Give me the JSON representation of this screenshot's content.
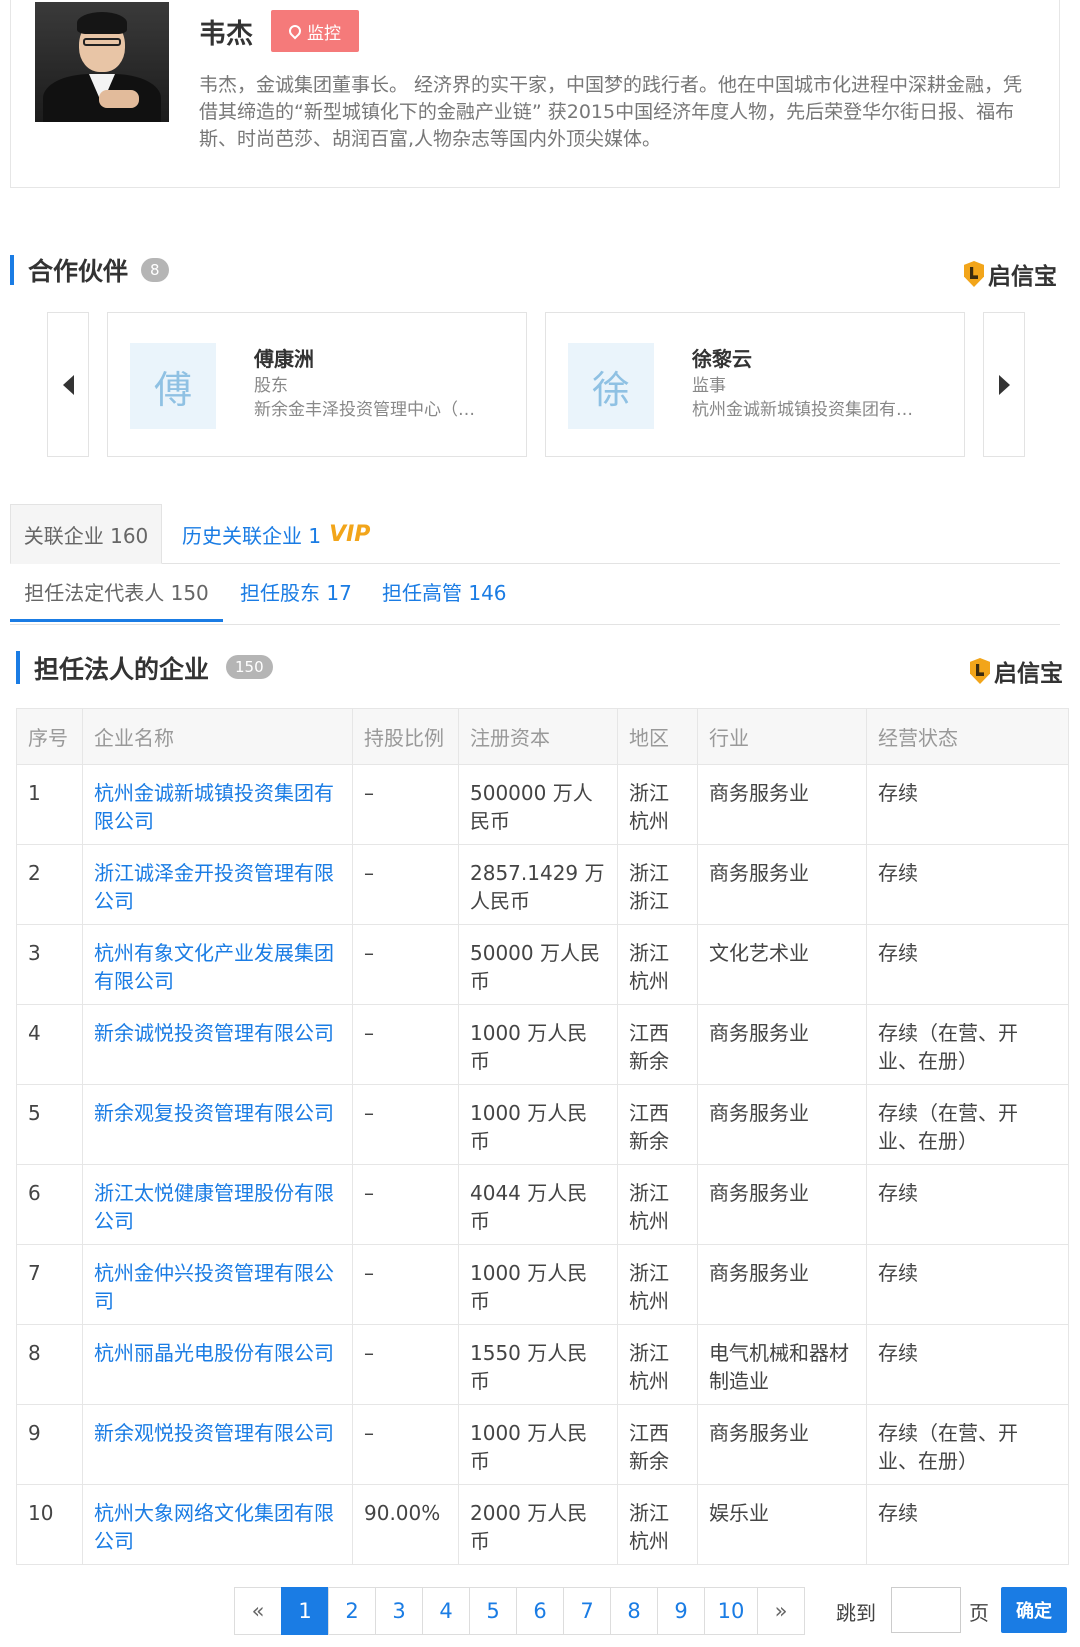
{
  "profile": {
    "name": "韦杰",
    "monitor_label": "监控",
    "bio": "韦杰，金诚集团董事长。 经济界的实干家，中国梦的践行者。他在中国城市化进程中深耕金融，凭借其缔造的“新型城镇化下的金融产业链” 获2015中国经济年度人物，先后荣登华尔街日报、福布斯、时尚芭莎、胡润百富,人物杂志等国内外顶尖媒体。"
  },
  "brand": {
    "label": "启信宝",
    "icon": "shield-icon"
  },
  "partners": {
    "title": "合作伙伴",
    "count": "8",
    "items": [
      {
        "avatar_char": "傅",
        "name": "傅康洲",
        "role": "股东",
        "company": "新余金丰泽投资管理中心（…"
      },
      {
        "avatar_char": "徐",
        "name": "徐黎云",
        "role": "监事",
        "company": "杭州金诚新城镇投资集团有…"
      }
    ]
  },
  "tabs": {
    "related_label": "关联企业 160",
    "history_label": "历史关联企业 1",
    "vip_label": "VIP"
  },
  "subtabs": {
    "legal_rep": "担任法定代表人 150",
    "shareholder": "担任股东 17",
    "executive": "担任高管 146"
  },
  "companies": {
    "title": "担任法人的企业",
    "count": "150",
    "headers": [
      "序号",
      "企业名称",
      "持股比例",
      "注册资本",
      "地区",
      "行业",
      "经营状态"
    ],
    "rows": [
      {
        "no": "1",
        "name": "杭州金诚新城镇投资集团有限公司",
        "ratio": "–",
        "capital": "500000 万人民币",
        "region": "浙江 杭州",
        "industry": "商务服务业",
        "status": "存续"
      },
      {
        "no": "2",
        "name": "浙江诚泽金开投资管理有限公司",
        "ratio": "–",
        "capital": "2857.1429 万人民币",
        "region": "浙江 浙江",
        "industry": "商务服务业",
        "status": "存续"
      },
      {
        "no": "3",
        "name": "杭州有象文化产业发展集团有限公司",
        "ratio": "–",
        "capital": "50000 万人民币",
        "region": "浙江 杭州",
        "industry": "文化艺术业",
        "status": "存续"
      },
      {
        "no": "4",
        "name": "新余诚悦投资管理有限公司",
        "ratio": "–",
        "capital": "1000 万人民币",
        "region": "江西 新余",
        "industry": "商务服务业",
        "status": "存续（在营、开业、在册）"
      },
      {
        "no": "5",
        "name": "新余观复投资管理有限公司",
        "ratio": "–",
        "capital": "1000 万人民币",
        "region": "江西 新余",
        "industry": "商务服务业",
        "status": "存续（在营、开业、在册）"
      },
      {
        "no": "6",
        "name": "浙江太悦健康管理股份有限公司",
        "ratio": "–",
        "capital": "4044 万人民币",
        "region": "浙江 杭州",
        "industry": "商务服务业",
        "status": "存续"
      },
      {
        "no": "7",
        "name": "杭州金仲兴投资管理有限公司",
        "ratio": "–",
        "capital": "1000 万人民币",
        "region": "浙江 杭州",
        "industry": "商务服务业",
        "status": "存续"
      },
      {
        "no": "8",
        "name": "杭州丽晶光电股份有限公司",
        "ratio": "–",
        "capital": "1550 万人民币",
        "region": "浙江 杭州",
        "industry": "电气机械和器材制造业",
        "status": "存续"
      },
      {
        "no": "9",
        "name": "新余观悦投资管理有限公司",
        "ratio": "–",
        "capital": "1000 万人民币",
        "region": "江西 新余",
        "industry": "商务服务业",
        "status": "存续（在营、开业、在册）"
      },
      {
        "no": "10",
        "name": "杭州大象网络文化集团有限公司",
        "ratio": "90.00%",
        "capital": "2000 万人民币",
        "region": "浙江 杭州",
        "industry": "娱乐业",
        "status": "存续"
      }
    ]
  },
  "pagination": {
    "prev": "«",
    "next": "»",
    "pages": [
      "1",
      "2",
      "3",
      "4",
      "5",
      "6",
      "7",
      "8",
      "9",
      "10"
    ],
    "current": "1",
    "jump_label": "跳到",
    "page_unit": "页",
    "confirm_label": "确定"
  }
}
